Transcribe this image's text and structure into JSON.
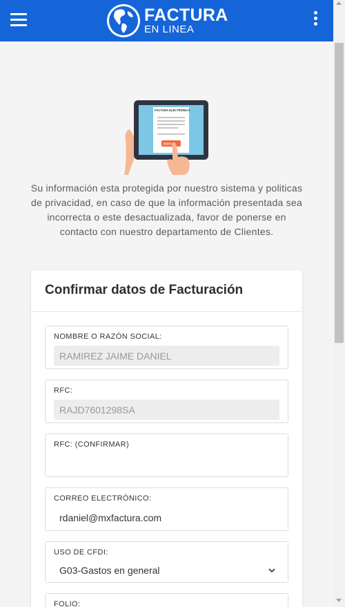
{
  "header": {
    "logo_line1": "FACTURA",
    "logo_line2": "EN LINEA",
    "menu_icon": "hamburger-menu-icon",
    "more_icon": "vertical-ellipsis-icon",
    "background": "#1565d8"
  },
  "illustration": {
    "doc_title": "FACTURA ELECTRÓNICA",
    "button_label": "ENVIAR"
  },
  "notice": "Su información esta protegida por nuestro sistema y politicas de privacidad, en caso de que la información presentada sea incorrecta o este desactualizada, favor de ponerse en contacto con nuestro departamento de Clientes.",
  "card": {
    "title": "Confirmar datos de Facturación",
    "fields": [
      {
        "label": "NOMBRE O RAZÓN SOCIAL:",
        "value": "RAMIREZ JAIME DANIEL",
        "readonly": true
      },
      {
        "label": "RFC:",
        "value": "RAJD7601298SA",
        "readonly": true
      },
      {
        "label": "RFC: (CONFIRMAR)",
        "value": "",
        "readonly": false
      },
      {
        "label": "CORREO ELECTRÓNICO:",
        "value": "rdaniel@mxfactura.com",
        "readonly": false
      },
      {
        "label": "USO DE CFDI:",
        "value": "G03-Gastos en general",
        "type": "select"
      },
      {
        "label": "FOLIO:",
        "value": ""
      }
    ]
  }
}
